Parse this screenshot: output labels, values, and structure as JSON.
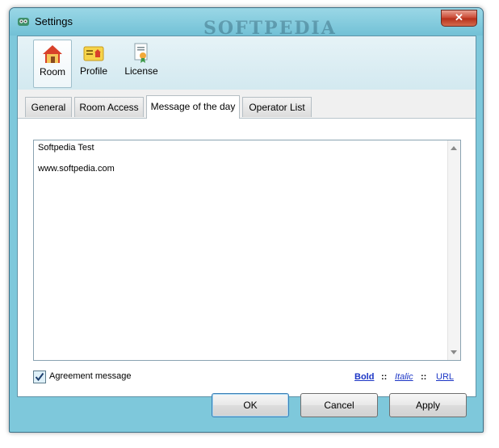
{
  "window": {
    "title": "Settings",
    "close_label": "✕",
    "watermark": "SOFTPEDIA"
  },
  "toolbar": {
    "items": [
      {
        "label": "Room",
        "icon": "house-icon",
        "active": true
      },
      {
        "label": "Profile",
        "icon": "profile-card-icon",
        "active": false
      },
      {
        "label": "License",
        "icon": "license-certificate-icon",
        "active": false
      }
    ]
  },
  "tabs": [
    {
      "label": "General"
    },
    {
      "label": "Room Access"
    },
    {
      "label": "Message of the day",
      "selected": true
    },
    {
      "label": "Operator List"
    }
  ],
  "message": {
    "lines": [
      "Softpedia Test",
      "www.softpedia.com"
    ]
  },
  "agreement": {
    "label": "Agreement message",
    "checked": true
  },
  "format": {
    "bold": "Bold",
    "italic": "Italic",
    "url": "URL",
    "separator": "::"
  },
  "buttons": {
    "ok": "OK",
    "cancel": "Cancel",
    "apply": "Apply"
  },
  "colors": {
    "frame": "#7ec8db",
    "link": "#1b35c5",
    "close": "#c8452f"
  }
}
